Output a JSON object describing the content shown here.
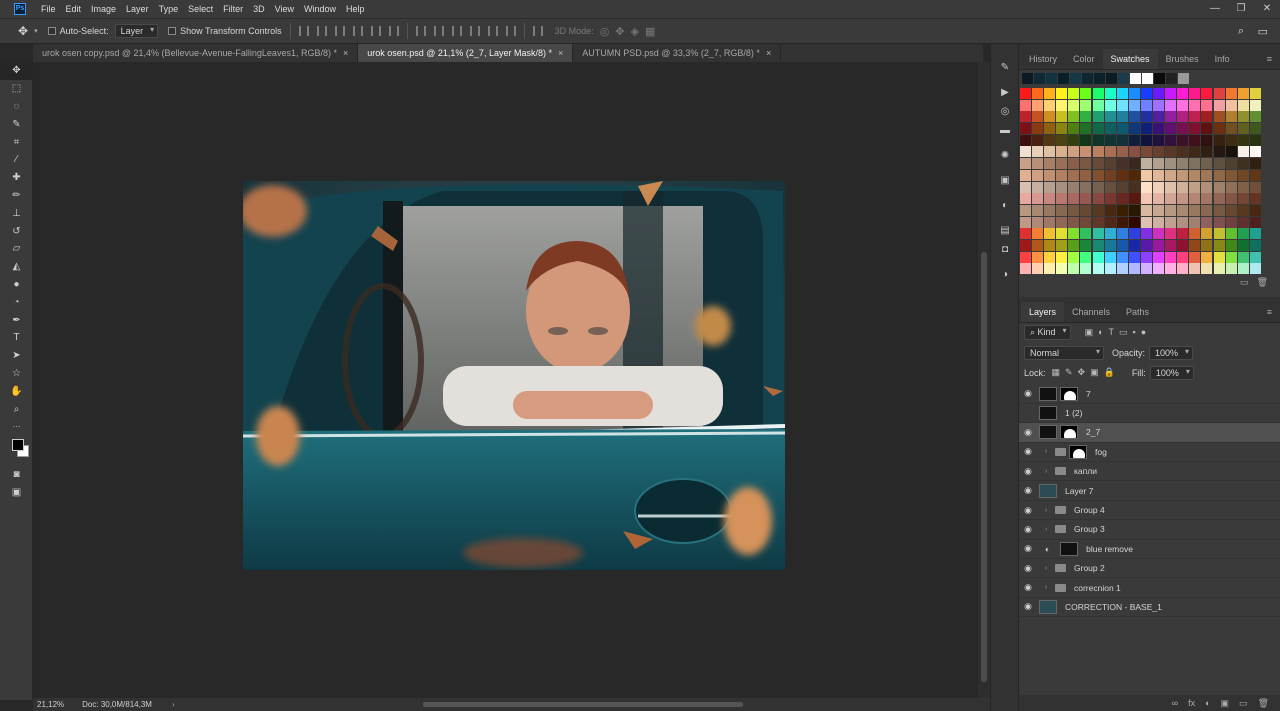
{
  "menu": {
    "logo": "Ps",
    "items": [
      "File",
      "Edit",
      "Image",
      "Layer",
      "Type",
      "Select",
      "Filter",
      "3D",
      "View",
      "Window",
      "Help"
    ],
    "window_controls": [
      "—",
      "❐",
      "✕"
    ]
  },
  "options_bar": {
    "auto_select_label": "Auto-Select:",
    "auto_select_value": "Layer",
    "show_transform_label": "Show Transform Controls",
    "mode_3d_label": "3D Mode:"
  },
  "tabs": [
    {
      "label": "urok osen copy.psd @ 21,4% (Bellevue-Avenue-FallingLeaves1, RGB/8) *",
      "active": false
    },
    {
      "label": "urok osen.psd @ 21,1% (2_7, Layer Mask/8) *",
      "active": true
    },
    {
      "label": "AUTUMN PSD.psd @ 33,3% (2_7, RGB/8) *",
      "active": false
    }
  ],
  "status": {
    "zoom": "21,12%",
    "doc": "Doc: 30,0M/814,3M"
  },
  "panel_tabs_top": [
    {
      "label": "History",
      "active": false
    },
    {
      "label": "Color",
      "active": false
    },
    {
      "label": "Swatches",
      "active": true
    },
    {
      "label": "Brushes",
      "active": false
    },
    {
      "label": "Info",
      "active": false
    }
  ],
  "recent_swatches": [
    "#0b1a22",
    "#0f2a35",
    "#123240",
    "#0a1e28",
    "#163846",
    "#0e2630",
    "#0c2229",
    "#0b1c24",
    "#1a3c4a",
    "#ffffff",
    "#ffffff",
    "#0a0a0a",
    "#222222",
    "#9a9a9a"
  ],
  "swatches": [
    "#ff1a1a",
    "#ff6a1a",
    "#ffb21a",
    "#fff21a",
    "#c8ff1a",
    "#6aff1a",
    "#1aff6a",
    "#1affc8",
    "#1ad6ff",
    "#1a8cff",
    "#1a3cff",
    "#6a1aff",
    "#c81aff",
    "#ff1ad6",
    "#ff1a8c",
    "#ff1a3c",
    "#e04040",
    "#f07830",
    "#f0a030",
    "#e0d040",
    "#ff7070",
    "#ffa070",
    "#ffd070",
    "#fff470",
    "#d8ff70",
    "#a0ff70",
    "#70ffa0",
    "#70ffe0",
    "#70e0ff",
    "#70b0ff",
    "#7080ff",
    "#a070ff",
    "#e070ff",
    "#ff70e0",
    "#ff70b0",
    "#ff7090",
    "#f0a0a0",
    "#f0c0a0",
    "#f0e0a0",
    "#f0f0c0",
    "#c0202a",
    "#c85020",
    "#d09020",
    "#c8c020",
    "#80c020",
    "#30b040",
    "#20a070",
    "#209090",
    "#2080a0",
    "#2050a0",
    "#2030a0",
    "#5020a0",
    "#9020a0",
    "#b02080",
    "#c02050",
    "#a02020",
    "#a05020",
    "#b08030",
    "#909030",
    "#609030",
    "#801018",
    "#8a3a10",
    "#906010",
    "#8a8410",
    "#508010",
    "#207028",
    "#106848",
    "#106060",
    "#105870",
    "#103878",
    "#102078",
    "#381078",
    "#601070",
    "#781050",
    "#801030",
    "#601010",
    "#6a3010",
    "#705020",
    "#606020",
    "#405820",
    "#401010",
    "#4a2010",
    "#503810",
    "#4a4410",
    "#304010",
    "#103818",
    "#103428",
    "#103434",
    "#10303c",
    "#10203c",
    "#10143c",
    "#20103c",
    "#34103c",
    "#3c1028",
    "#40101c",
    "#301010",
    "#382010",
    "#3c2c10",
    "#343410",
    "#283410",
    "#f0e0d0",
    "#e8d0b8",
    "#e0c0a0",
    "#d8b090",
    "#d0a080",
    "#c89070",
    "#b88060",
    "#a87050",
    "#986048",
    "#885040",
    "#784838",
    "#684030",
    "#5a3828",
    "#4c3020",
    "#3e2818",
    "#302010",
    "#241810",
    "#18120a",
    "#f8f0e8",
    "#fff8f0",
    "#c8a088",
    "#b89078",
    "#a88068",
    "#987058",
    "#886048",
    "#785840",
    "#684838",
    "#584030",
    "#483028",
    "#382820",
    "#c0b0a0",
    "#b0a090",
    "#a09080",
    "#908070",
    "#807060",
    "#706050",
    "#605040",
    "#504030",
    "#403020",
    "#302010",
    "#e0b090",
    "#d0a080",
    "#c09070",
    "#b08060",
    "#a07050",
    "#906040",
    "#805030",
    "#704020",
    "#603010",
    "#502808",
    "#f0c8a8",
    "#e0b898",
    "#d0a888",
    "#c09878",
    "#b08868",
    "#a07858",
    "#906848",
    "#805838",
    "#704828",
    "#603818",
    "#d8c0b0",
    "#c8b0a0",
    "#b8a090",
    "#a89080",
    "#988070",
    "#887060",
    "#786050",
    "#685040",
    "#584030",
    "#483020",
    "#ffe0c8",
    "#f0d0b8",
    "#e0c0a8",
    "#d0b098",
    "#c0a088",
    "#b09078",
    "#a08068",
    "#907058",
    "#806048",
    "#705038",
    "#e8a8a0",
    "#d89890",
    "#c88880",
    "#b87870",
    "#a86860",
    "#985850",
    "#884840",
    "#783830",
    "#682820",
    "#581810",
    "#f4c4b4",
    "#e4b4a4",
    "#d4a494",
    "#c49484",
    "#b48474",
    "#a47464",
    "#946454",
    "#845444",
    "#744434",
    "#643424",
    "#b89880",
    "#a88870",
    "#987860",
    "#886850",
    "#785840",
    "#684830",
    "#583820",
    "#482810",
    "#382000",
    "#281800",
    "#d8b8a0",
    "#c8a890",
    "#b89880",
    "#a88870",
    "#987860",
    "#886850",
    "#785840",
    "#684830",
    "#583820",
    "#482810",
    "#c09888",
    "#b08878",
    "#a07868",
    "#906858",
    "#805848",
    "#704838",
    "#603828",
    "#502818",
    "#401808",
    "#300800",
    "#e0c0b0",
    "#d0b0a0",
    "#c0a090",
    "#b09080",
    "#a08070",
    "#906060",
    "#805050",
    "#704040",
    "#603030",
    "#502020",
    "#e03030",
    "#f08030",
    "#f0c030",
    "#e0e030",
    "#80e030",
    "#30c060",
    "#30c0a0",
    "#30b0d0",
    "#3080e0",
    "#3040e0",
    "#8030e0",
    "#d030c0",
    "#e03080",
    "#c02040",
    "#d06030",
    "#d0a030",
    "#c0c030",
    "#60c030",
    "#20a050",
    "#20a090",
    "#a01818",
    "#b05818",
    "#b08818",
    "#a0a018",
    "#58a018",
    "#188838",
    "#188870",
    "#187898",
    "#1858a8",
    "#1828a8",
    "#5818a8",
    "#9818a0",
    "#a81860",
    "#901030",
    "#904818",
    "#907018",
    "#888818",
    "#408818",
    "#107030",
    "#107060",
    "#ff4040",
    "#ff9040",
    "#ffd040",
    "#fff040",
    "#a0ff40",
    "#40ff80",
    "#40ffd0",
    "#40d0ff",
    "#4090ff",
    "#4050ff",
    "#9040ff",
    "#e040ff",
    "#ff40c0",
    "#ff4080",
    "#e06040",
    "#f0b040",
    "#e0e040",
    "#80e040",
    "#40c070",
    "#40c0b0",
    "#ffb0b0",
    "#ffd0b0",
    "#fff0b0",
    "#f0ffb0",
    "#c0ffb0",
    "#b0ffd0",
    "#b0fff0",
    "#b0f0ff",
    "#b0d0ff",
    "#b0b8ff",
    "#d0b0ff",
    "#f0b0ff",
    "#ffb0e0",
    "#ffb0c8",
    "#f0c0b0",
    "#f0e0b0",
    "#e8f0b0",
    "#c8f0b0",
    "#b0f0c8",
    "#b0e8f0"
  ],
  "layer_tabs": [
    {
      "label": "Layers",
      "active": true
    },
    {
      "label": "Channels",
      "active": false
    },
    {
      "label": "Paths",
      "active": false
    }
  ],
  "layer_controls": {
    "kind_label": "Kind",
    "blend_mode": "Normal",
    "opacity_label": "Opacity:",
    "opacity_value": "100%",
    "lock_label": "Lock:",
    "fill_label": "Fill:",
    "fill_value": "100%"
  },
  "layers": [
    {
      "name": "7",
      "type": "layer-mask",
      "visible": true,
      "selected": false
    },
    {
      "name": "1 (2)",
      "type": "layer",
      "visible": false,
      "selected": false
    },
    {
      "name": "2_7",
      "type": "layer-mask",
      "visible": true,
      "selected": true
    },
    {
      "name": "fog",
      "type": "group-mask",
      "visible": true,
      "selected": false
    },
    {
      "name": "капли",
      "type": "group",
      "visible": true,
      "selected": false
    },
    {
      "name": "Layer 7",
      "type": "layer",
      "visible": true,
      "selected": false
    },
    {
      "name": "Group 4",
      "type": "group",
      "visible": true,
      "selected": false
    },
    {
      "name": "Group 3",
      "type": "group",
      "visible": true,
      "selected": false
    },
    {
      "name": "blue remove",
      "type": "adjustment",
      "visible": true,
      "selected": false
    },
    {
      "name": "Group 2",
      "type": "group",
      "visible": true,
      "selected": false
    },
    {
      "name": "correcnion 1",
      "type": "group",
      "visible": true,
      "selected": false
    },
    {
      "name": "CORRECTION - BASE_1",
      "type": "layer",
      "visible": true,
      "selected": false
    }
  ],
  "layers_footer": [
    "fx",
    "◐",
    "▣",
    "▭",
    "🗑"
  ]
}
